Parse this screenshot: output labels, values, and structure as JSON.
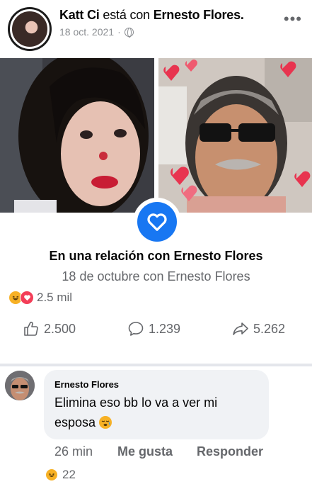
{
  "post": {
    "author": "Katt Ci",
    "connector": "está con",
    "tagged": "Ernesto Flores.",
    "date": "18 oct. 2021",
    "date_separator": "·",
    "privacy_icon": "globe-icon",
    "more_icon": "more-options-icon"
  },
  "life_event": {
    "title": "En una relación con Ernesto Flores",
    "subtitle": "18 de octubre con Ernesto Flores",
    "badge_icon": "heart-icon",
    "badge_color": "#1877f2"
  },
  "reactions": {
    "icons": [
      "haha-icon",
      "love-icon"
    ],
    "total": "2.5 mil"
  },
  "stats": {
    "likes": "2.500",
    "comments": "1.239",
    "shares": "5.262"
  },
  "comment": {
    "author": "Ernesto Flores",
    "text": "Elimina eso bb lo va a ver mi esposa",
    "time": "26 min",
    "like_label": "Me gusta",
    "reply_label": "Responder",
    "reaction_icon": "haha-icon",
    "reaction_count": "22"
  },
  "colors": {
    "accent": "#1877f2",
    "haha": "#f7b125",
    "love": "#f33e58",
    "secondary_text": "#65676b"
  }
}
